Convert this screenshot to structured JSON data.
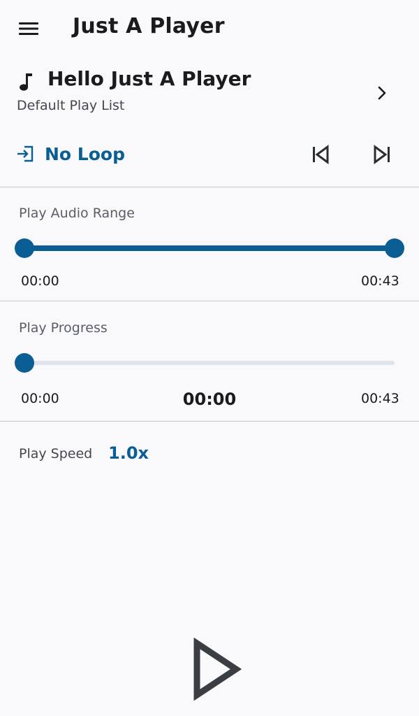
{
  "app": {
    "title": "Just A Player"
  },
  "track": {
    "title": "Hello Just A Player",
    "playlist": "Default Play List"
  },
  "loop": {
    "label": "No Loop"
  },
  "range": {
    "label": "Play Audio Range",
    "start_time": "00:00",
    "end_time": "00:43",
    "start_fraction": 0.0,
    "end_fraction": 1.0
  },
  "progress": {
    "label": "Play Progress",
    "start_time": "00:00",
    "current_time": "00:00",
    "end_time": "00:43",
    "fraction": 0.0
  },
  "speed": {
    "label": "Play Speed",
    "value": "1.0x"
  },
  "colors": {
    "accent": "#0b5e93",
    "background": "#f9f9fc",
    "track_inactive": "#dfe3eb",
    "icon": "#3a3d42"
  },
  "icons": {
    "menu": "menu-icon",
    "note": "music-note-icon",
    "chevron": "chevron-right-icon",
    "loop": "login-arrow-icon",
    "prev": "skip-previous-icon",
    "next": "skip-next-icon",
    "play": "play-icon"
  }
}
